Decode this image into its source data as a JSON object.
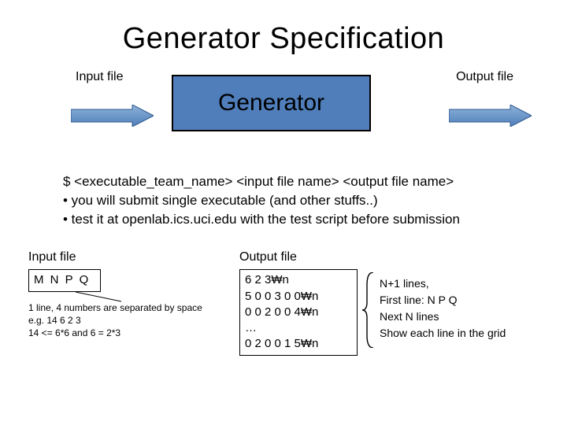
{
  "title": "Generator Specification",
  "flow": {
    "input_label": "Input file",
    "output_label": "Output file",
    "box_label": "Generator"
  },
  "notes": {
    "line1": "$ <executable_team_name> <input file name> <output file name>",
    "line2": "• you will submit single executable (and other stuffs..)",
    "line3": "• test it at openlab.ics.uci.edu with the test script before submission"
  },
  "input_section": {
    "heading": "Input file",
    "box_text": "M N P Q",
    "desc1": "1 line, 4 numbers are separated by space",
    "desc2": "e.g. 14 6 2 3",
    "desc3": "14 <= 6*6 and 6 = 2*3"
  },
  "output_section": {
    "heading": "Output file",
    "l1": "6 2 3₩n",
    "l2": "5 0 0 3 0 0₩n",
    "l3": "0 0 2 0 0 4₩n",
    "l4": "…",
    "l5": "0 2 0 0 1 5₩n",
    "desc1": "N+1 lines,",
    "desc2": "First line: N P Q",
    "desc3": "Next N lines",
    "desc4": "Show each line in the grid"
  }
}
